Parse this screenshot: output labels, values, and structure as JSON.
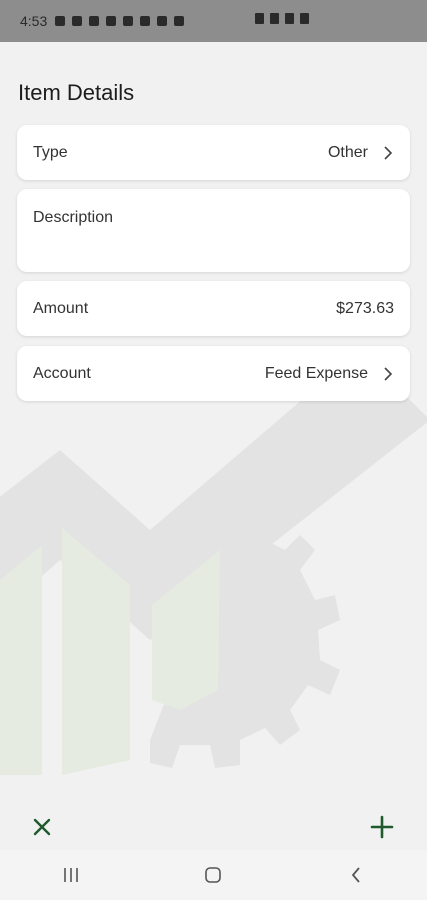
{
  "status_bar": {
    "time": "4:53"
  },
  "page": {
    "title": "Item Details"
  },
  "fields": {
    "type": {
      "label": "Type",
      "value": "Other"
    },
    "description": {
      "label": "Description"
    },
    "amount": {
      "label": "Amount",
      "value": "$273.63"
    },
    "account": {
      "label": "Account",
      "value": "Feed Expense"
    }
  },
  "colors": {
    "accent": "#1f5a2e",
    "background": "#f1f1f1",
    "card": "#ffffff"
  },
  "icons": {
    "close": "close-icon",
    "add": "plus-icon",
    "chevron": "chevron-right-icon",
    "nav_recents": "recents-icon",
    "nav_home": "home-icon",
    "nav_back": "back-icon"
  }
}
